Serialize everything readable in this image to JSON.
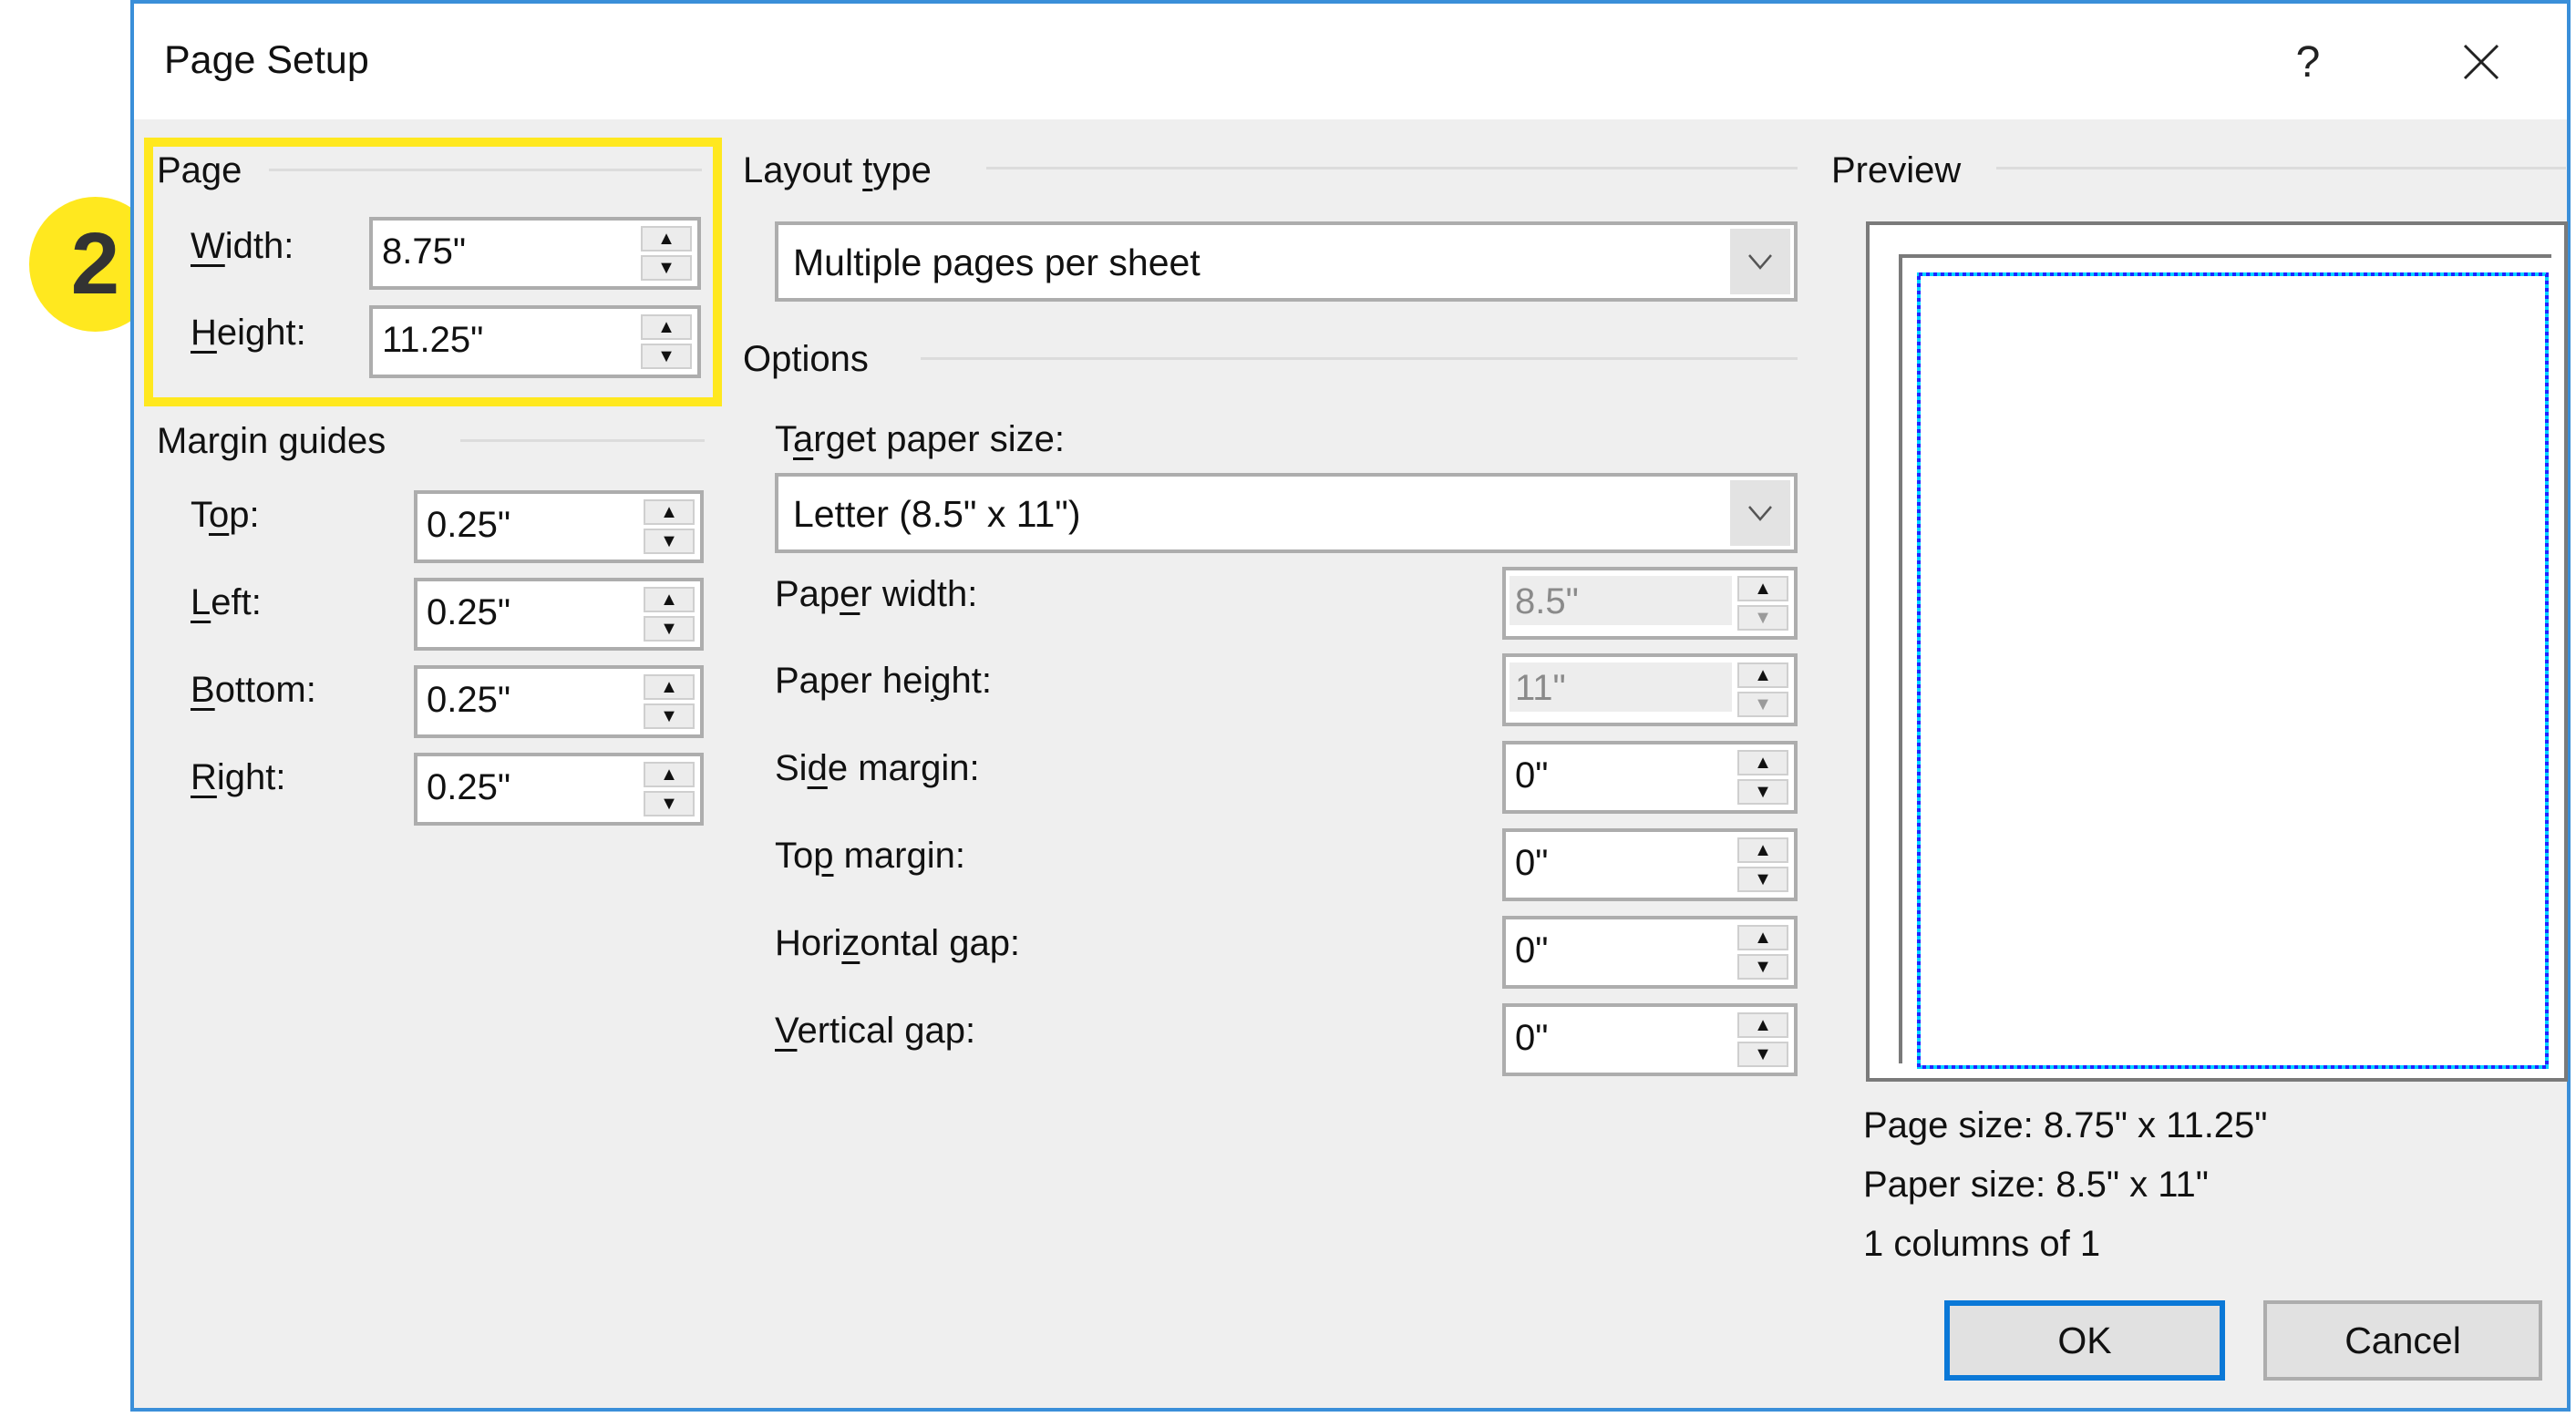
{
  "dialog": {
    "title": "Page Setup",
    "help_label": "?",
    "close_icon": "close-icon",
    "accent_color": "#3a8fd9"
  },
  "annotation": {
    "badge_number": "2",
    "highlight_color": "#ffe81f"
  },
  "page": {
    "group_label": "Page",
    "width": {
      "label_pre": "",
      "label_u": "W",
      "label_post": "idth:",
      "value": "8.75\""
    },
    "height": {
      "label_pre": "",
      "label_u": "H",
      "label_post": "eight:",
      "value": "11.25\""
    }
  },
  "margin_guides": {
    "group_label": "Margin guides",
    "fields": [
      {
        "label_pre": "T",
        "label_u": "o",
        "label_post": "p:",
        "value": "0.25\""
      },
      {
        "label_pre": "",
        "label_u": "L",
        "label_post": "eft:",
        "value": "0.25\""
      },
      {
        "label_pre": "",
        "label_u": "B",
        "label_post": "ottom:",
        "value": "0.25\""
      },
      {
        "label_pre": "",
        "label_u": "R",
        "label_post": "ight:",
        "value": "0.25\""
      }
    ]
  },
  "layout_type": {
    "group_label_pre": "Layout ",
    "group_label_u": "t",
    "group_label_post": "ype",
    "selected": "Multiple pages per sheet"
  },
  "options": {
    "group_label": "Options",
    "target_paper_size": {
      "label_pre": "T",
      "label_u": "a",
      "label_post": "rget paper size:",
      "selected": "Letter (8.5\" x 11\")"
    },
    "fields": [
      {
        "label_pre": "Pap",
        "label_u": "e",
        "label_post": "r width:",
        "value": "8.5\"",
        "disabled": true
      },
      {
        "label_pre": "Paper hei",
        "label_u": "g",
        "label_post": "ht:",
        "value": "11\"",
        "disabled": true
      },
      {
        "label_pre": "Si",
        "label_u": "d",
        "label_post": "e margin:",
        "value": "0\"",
        "disabled": false
      },
      {
        "label_pre": "To",
        "label_u": "p",
        "label_post": " margin:",
        "value": "0\"",
        "disabled": false
      },
      {
        "label_pre": "Hori",
        "label_u": "z",
        "label_post": "ontal gap:",
        "value": "0\"",
        "disabled": false
      },
      {
        "label_pre": "",
        "label_u": "V",
        "label_post": "ertical gap:",
        "value": "0\"",
        "disabled": false
      }
    ]
  },
  "preview": {
    "group_label": "Preview",
    "page_size": "Page size: 8.75\" x 11.25\"",
    "paper_size": "Paper size: 8.5\" x 11\"",
    "columns": "1 columns of 1"
  },
  "buttons": {
    "ok": "OK",
    "cancel": "Cancel"
  }
}
